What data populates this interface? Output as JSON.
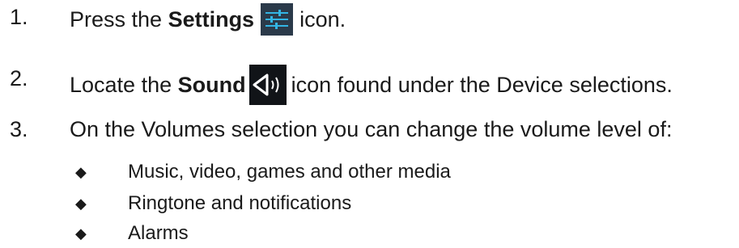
{
  "steps": [
    {
      "number": "1.",
      "before": "Press the ",
      "bold": "Settings",
      "icon": "settings-sliders-icon",
      "after": "icon."
    },
    {
      "number": "2.",
      "before": "Locate the ",
      "bold": "Sound",
      "icon": "speaker-sound-icon",
      "after": "icon found under the Device selections."
    },
    {
      "number": "3.",
      "text": "On the Volumes selection you can change the volume level of:"
    }
  ],
  "bullets": [
    "Music, video, games and other media",
    "Ringtone and notifications",
    "Alarms"
  ],
  "bullet_glyph": "◆",
  "colors": {
    "text": "#1a1a1a",
    "icon_bg": "#111418",
    "settings_icon_bg": "#2b3a4a",
    "settings_icon_accent": "#33b5e5",
    "speaker_icon_fg": "#ffffff"
  }
}
